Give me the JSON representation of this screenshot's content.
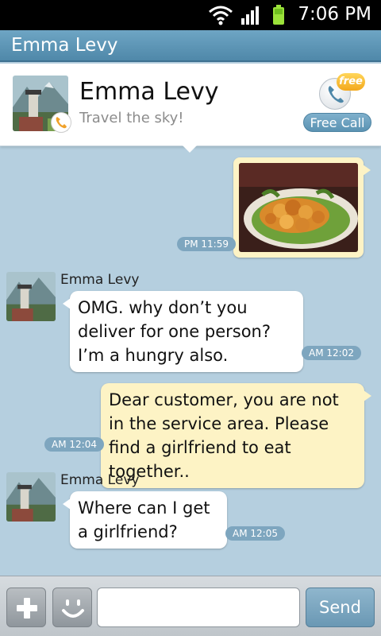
{
  "status_bar": {
    "time": "7:06 PM"
  },
  "window": {
    "title": "Emma Levy"
  },
  "profile": {
    "name": "Emma Levy",
    "status_message": "Travel the sky!",
    "free_badge": "free",
    "free_call_label": "Free Call"
  },
  "messages": [
    {
      "direction": "out",
      "type": "image",
      "image_icon": "food-dish-photo",
      "time": "PM 11:59"
    },
    {
      "direction": "in",
      "sender": "Emma Levy",
      "text": "OMG. why don’t you deliver for one person? I’m a hungry also.",
      "time": "AM 12:02"
    },
    {
      "direction": "out",
      "text": "Dear customer, you are not in the service area. Please find a girlfriend to eat together..",
      "time": "AM 12:04"
    },
    {
      "direction": "in",
      "sender": "Emma Levy",
      "text": "Where can I get a girlfriend?",
      "time": "AM 12:05"
    }
  ],
  "input_bar": {
    "message_value": "",
    "send_label": "Send"
  },
  "colors": {
    "chat_background": "#b5cfdf",
    "title_bar": "#5b93b3",
    "incoming_bubble": "#ffffff",
    "outgoing_bubble": "#fdf3c5",
    "time_badge": "#7ea6bf"
  }
}
